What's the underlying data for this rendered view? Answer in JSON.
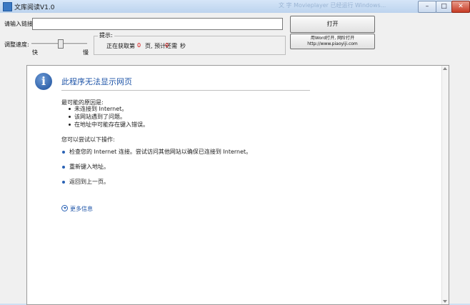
{
  "window": {
    "title": "文库阅读V1.0",
    "background_ghost_text": "文 字 Movieplayer 已经运行 Windows..."
  },
  "toolbar": {
    "url_label": "请输入链接:",
    "url_value": "",
    "open_button": "打开",
    "speed_label": "调整速度:",
    "speed_fast": "快",
    "speed_slow": "慢",
    "speed_value": 0.5,
    "tip_legend": "提示:",
    "tip_prefix": "正在获取第",
    "tip_page": "0",
    "tip_mid": "页, 预计还需",
    "tip_seconds": "0",
    "tip_suffix": "秒",
    "word_button_line1": "用Word打开, 网阶打开",
    "word_button_line2": "http://www.piaoyiji.com"
  },
  "error_page": {
    "title": "此程序无法显示网页",
    "causes_header": "最可能的原因是:",
    "causes": [
      "未连接到 Internet。",
      "该网站遇到了问题。",
      "在地址中可能存在键入错误。"
    ],
    "actions_header": "您可以尝试以下操作:",
    "actions": [
      "检查您的 Internet 连接。尝试访问其他网站以确保已连接到 Internet。",
      "重新键入地址。",
      "返回到上一页。"
    ],
    "more_info": "更多信息"
  },
  "colors": {
    "link_blue": "#1f55a8",
    "counter_red": "#d60000"
  }
}
